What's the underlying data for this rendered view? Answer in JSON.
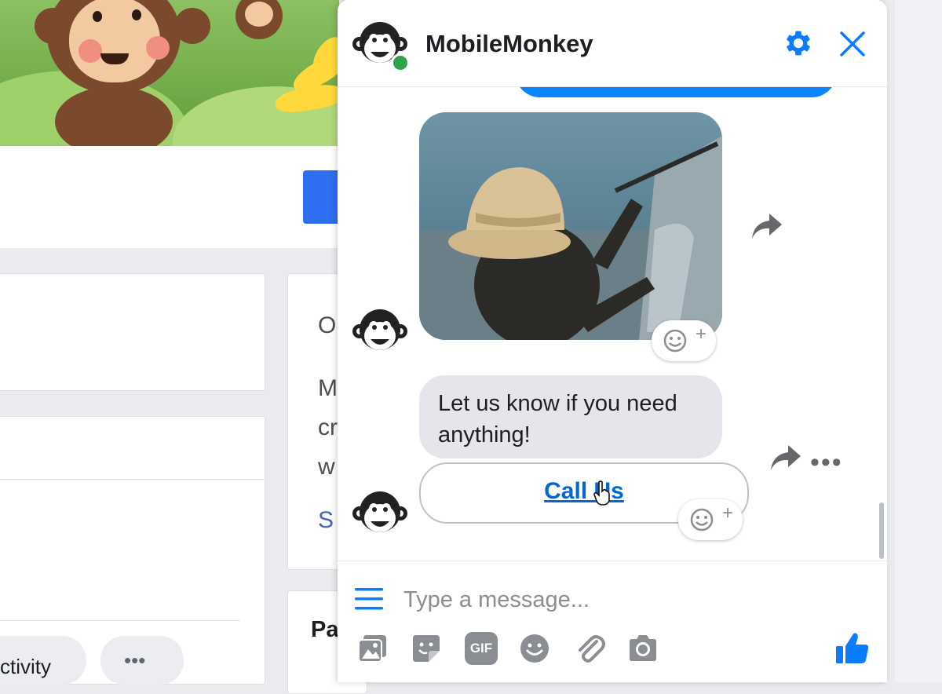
{
  "background_page": {
    "card_fragments": [
      "O",
      "M",
      "cr",
      "w"
    ],
    "card_link_fragment": "S",
    "section_fragment": "Pa",
    "activity_pill_label": "ctivity",
    "more_pill_label": "•••"
  },
  "chat": {
    "title": "MobileMonkey",
    "status": "online",
    "messages": {
      "text": "Let us know if you need anything!",
      "button_label": "Call Us"
    },
    "more_label": "•••",
    "composer": {
      "placeholder": "Type a message...",
      "value": ""
    },
    "toolbar_icons": [
      "image-icon",
      "sticker-icon",
      "gif-icon",
      "emoji-icon",
      "attachment-icon",
      "camera-icon"
    ],
    "gif_icon_label": "GIF",
    "accent_color": "#0a84ff"
  }
}
